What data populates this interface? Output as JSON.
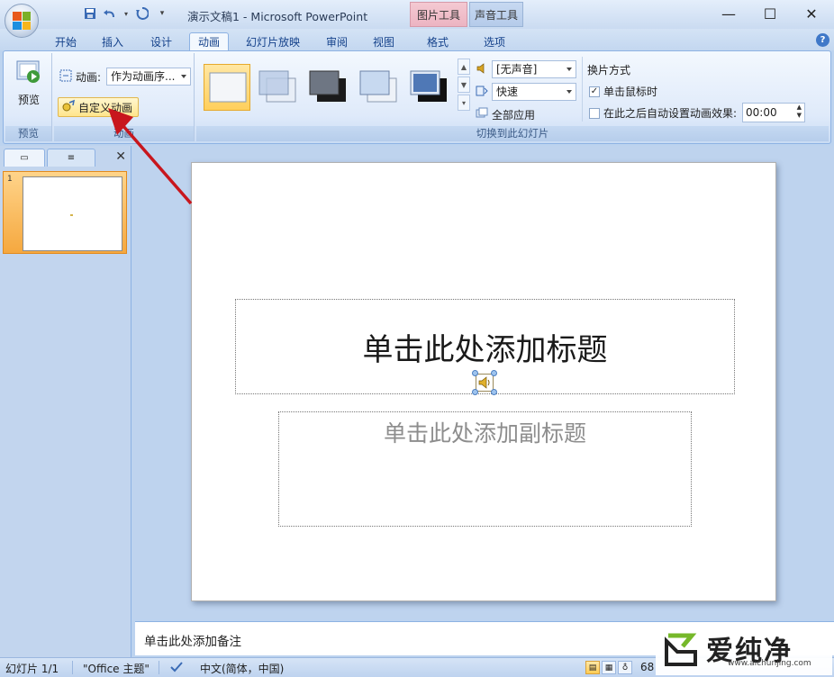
{
  "window": {
    "title": "演示文稿1 - Microsoft PowerPoint",
    "context_tab_picture": "图片工具",
    "context_tab_sound": "声音工具"
  },
  "tabs": [
    "开始",
    "插入",
    "设计",
    "动画",
    "幻灯片放映",
    "审阅",
    "视图",
    "格式",
    "选项"
  ],
  "active_tab": "动画",
  "ribbon": {
    "preview": {
      "button_label": "预览",
      "group_label": "预览"
    },
    "animations": {
      "animate_label": "动画:",
      "animate_value": "作为动画序...",
      "custom_animation_label": "自定义动画",
      "group_label": "动画"
    },
    "transition": {
      "sound_value": "[无声音]",
      "speed_value": "快速",
      "apply_all_label": "全部应用",
      "advance_heading": "换片方式",
      "on_click_label": "单击鼠标时",
      "on_click_checked": true,
      "auto_after_label": "在此之后自动设置动画效果:",
      "auto_after_checked": false,
      "auto_after_time": "00:00",
      "group_label": "切换到此幻灯片"
    }
  },
  "slides_pane": {
    "slide_number": "1"
  },
  "slide": {
    "title_placeholder": "单击此处添加标题",
    "subtitle_placeholder": "单击此处添加副标题"
  },
  "notes": {
    "placeholder": "单击此处添加备注"
  },
  "status_bar": {
    "slide_count": "幻灯片 1/1",
    "theme": "\"Office 主题\"",
    "language": "中文(简体，中国)",
    "zoom": "68"
  },
  "watermark": {
    "brand": "爱纯净",
    "url": "www.aichunjing.com"
  }
}
